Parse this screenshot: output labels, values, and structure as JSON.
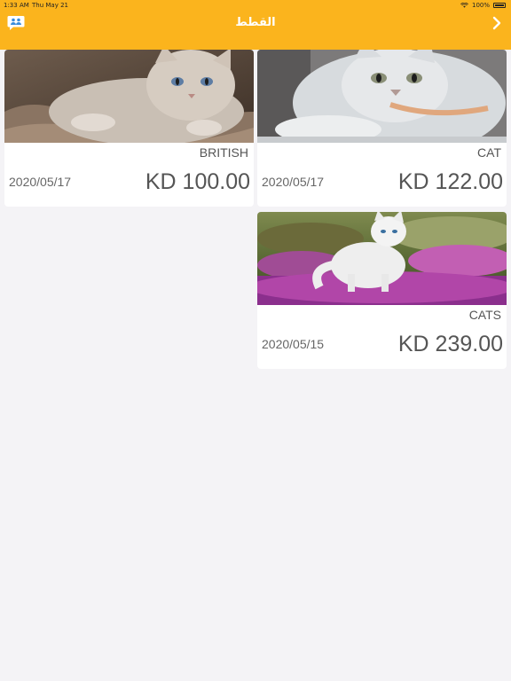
{
  "status": {
    "time": "1:33 AM",
    "date": "Thu May 21",
    "battery": "100%"
  },
  "header": {
    "title": "القطط"
  },
  "colors": {
    "accent": "#fbb41d",
    "background": "#f4f3f6",
    "card": "#ffffff",
    "text": "#555555"
  },
  "listings": [
    {
      "name": "BRITISH",
      "date": "2020/05/17",
      "price": "KD 100.00"
    },
    {
      "name": "CAT",
      "date": "2020/05/17",
      "price": "KD 122.00"
    },
    {
      "name": "CATS",
      "date": "2020/05/15",
      "price": "KD 239.00"
    }
  ]
}
